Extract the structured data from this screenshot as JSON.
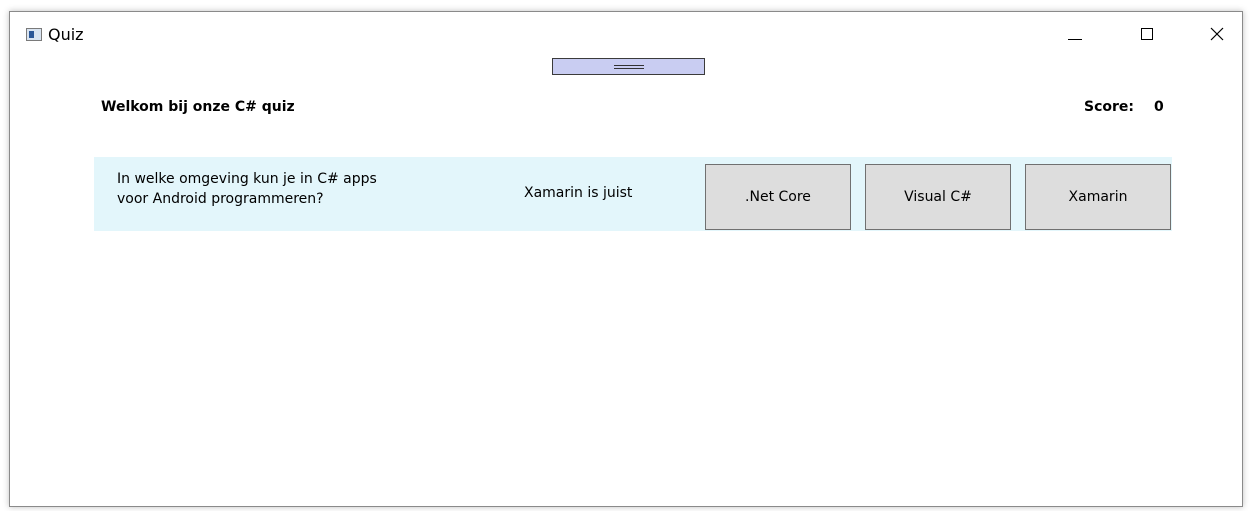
{
  "window": {
    "title": "Quiz",
    "minimize_glyph": "",
    "maximize_glyph": "",
    "close_glyph": "✕"
  },
  "header": {
    "welcome": "Welkom bij onze C# quiz",
    "score_label": "Score:",
    "score_value": "0"
  },
  "question": {
    "line1": "In welke omgeving kun je in C# apps",
    "line2": "voor Android programmeren?",
    "feedback": "Xamarin is juist",
    "answers": [
      ".Net Core",
      "Visual C#",
      "Xamarin"
    ]
  },
  "colors": {
    "question_background": "#e3f6fb",
    "button_background": "#dddddd",
    "grip_background": "#c9cdf2"
  },
  "icons": {
    "app": "app-window-icon",
    "grip": "drag-handle-icon"
  }
}
